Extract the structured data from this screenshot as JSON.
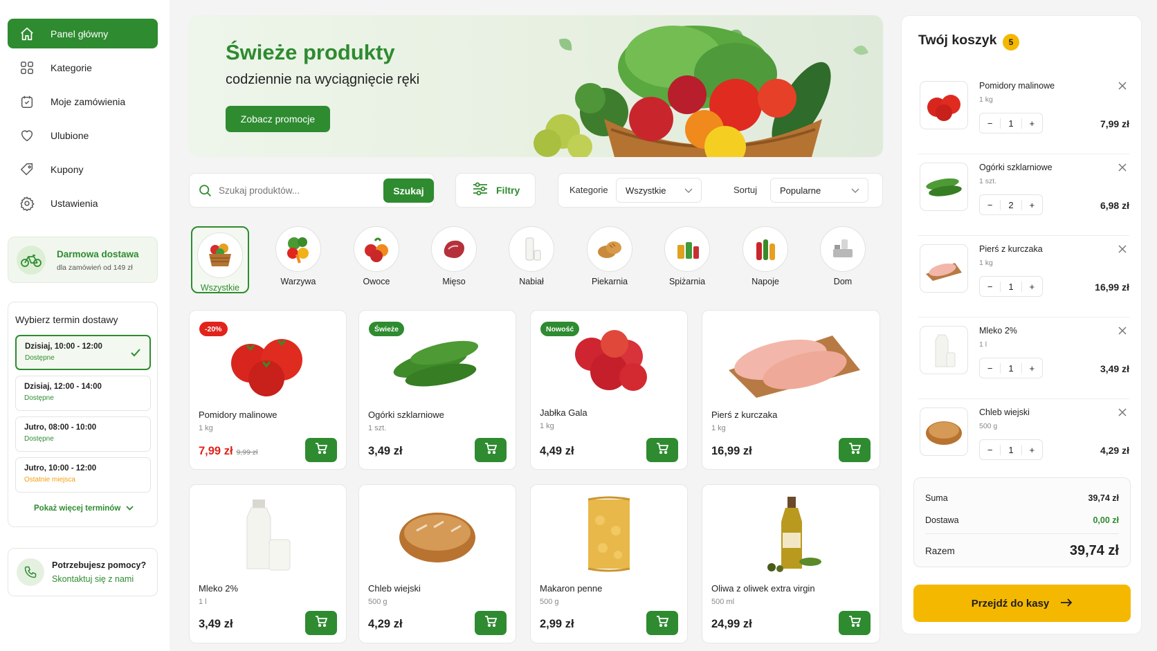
{
  "sidebar": {
    "nav": [
      {
        "label": "Panel główny",
        "icon": "home-icon",
        "active": true
      },
      {
        "label": "Kategorie",
        "icon": "grid-icon"
      },
      {
        "label": "Moje zamówienia",
        "icon": "calendar-icon"
      },
      {
        "label": "Ulubione",
        "icon": "heart-icon"
      },
      {
        "label": "Kupony",
        "icon": "tag-icon"
      },
      {
        "label": "Ustawienia",
        "icon": "gear-icon"
      }
    ],
    "free_delivery": {
      "title": "Darmowa dostawa",
      "subtitle": "dla zamówień od 149 zł"
    },
    "delivery": {
      "title": "Wybierz termin dostawy",
      "slots": [
        {
          "time": "Dzisiaj, 10:00 - 12:00",
          "status": "Dostępne",
          "selected": true
        },
        {
          "time": "Dzisiaj, 12:00 - 14:00",
          "status": "Dostępne"
        },
        {
          "time": "Jutro, 08:00 - 10:00",
          "status": "Dostępne"
        },
        {
          "time": "Jutro, 10:00 - 12:00",
          "status": "Ostatnie miejsca"
        }
      ],
      "more": "Pokaż więcej terminów"
    },
    "help": {
      "title": "Potrzebujesz pomocy?",
      "link": "Skontaktuj się z nami"
    }
  },
  "hero": {
    "title": "Świeże produkty",
    "subtitle": "codziennie na wyciągnięcie ręki",
    "button": "Zobacz promocje"
  },
  "search": {
    "placeholder": "Szukaj produktów...",
    "button": "Szukaj",
    "filters": "Filtry"
  },
  "filters": {
    "category_label": "Kategorie",
    "category_value": "Wszystkie",
    "sort_label": "Sortuj",
    "sort_value": "Popularne"
  },
  "categories": [
    "Wszystkie",
    "Warzywa",
    "Owoce",
    "Mięso",
    "Nabiał",
    "Piekarnia",
    "Spiżarnia",
    "Napoje",
    "Dom"
  ],
  "products": [
    {
      "name": "Pomidory malinowe",
      "unit": "1 kg",
      "price": "7,99 zł",
      "old_price": "9,99 zł",
      "badge": "-20%"
    },
    {
      "name": "Ogórki szklarniowe",
      "unit": "1 szt.",
      "price": "3,49 zł",
      "badge": "Świeże"
    },
    {
      "name": "Jabłka Gala",
      "unit": "1 kg",
      "price": "4,49 zł",
      "badge": "Nowość"
    },
    {
      "name": "Pierś z kurczaka",
      "unit": "1 kg",
      "price": "16,99 zł"
    },
    {
      "name": "Mleko 2%",
      "unit": "1 l",
      "price": "3,49 zł"
    },
    {
      "name": "Chleb wiejski",
      "unit": "500 g",
      "price": "4,29 zł"
    },
    {
      "name": "Makaron penne",
      "unit": "500 g",
      "price": "2,99 zł"
    },
    {
      "name": "Oliwa z oliwek extra virgin",
      "unit": "500 ml",
      "price": "24,99 zł"
    }
  ],
  "cart": {
    "title": "Twój koszyk",
    "count": "5",
    "items": [
      {
        "name": "Pomidory malinowe",
        "unit": "1 kg",
        "qty": "1",
        "price": "7,99 zł"
      },
      {
        "name": "Ogórki szklarniowe",
        "unit": "1 szt.",
        "qty": "2",
        "price": "6,98 zł"
      },
      {
        "name": "Pierś z kurczaka",
        "unit": "1 kg",
        "qty": "1",
        "price": "16,99 zł"
      },
      {
        "name": "Mleko 2%",
        "unit": "1 l",
        "qty": "1",
        "price": "3,49 zł"
      },
      {
        "name": "Chleb wiejski",
        "unit": "500 g",
        "qty": "1",
        "price": "4,29 zł"
      }
    ],
    "sum_label": "Suma",
    "sum": "39,74 zł",
    "delivery_label": "Dostawa",
    "delivery": "0,00 zł",
    "total_label": "Razem",
    "total": "39,74 zł",
    "checkout": "Przejdź do kasy"
  },
  "colors": {
    "accent": "#2e8b30",
    "checkout": "#f5b800",
    "discount": "#e0241b"
  }
}
